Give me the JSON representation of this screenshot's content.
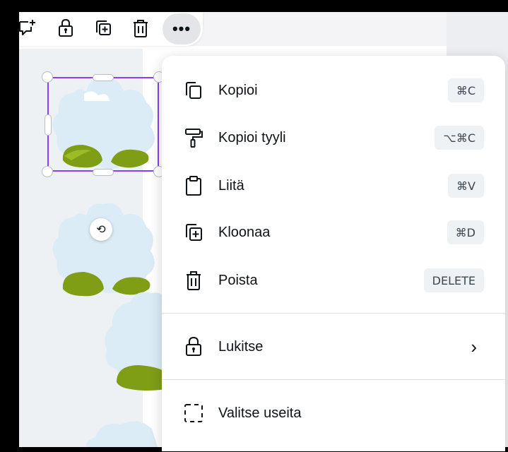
{
  "toolbar": {
    "icons": [
      "comment-add-icon",
      "lock-icon",
      "duplicate-icon",
      "trash-icon"
    ],
    "more_label": "•••"
  },
  "canvas": {
    "rotate_glyph": "⟲"
  },
  "menu": {
    "items": [
      {
        "label": "Kopioi",
        "shortcut": "⌘C",
        "icon": "copy-icon"
      },
      {
        "label": "Kopioi tyyli",
        "shortcut": "⌥⌘C",
        "icon": "paint-roller-icon"
      },
      {
        "label": "Liitä",
        "shortcut": "⌘V",
        "icon": "clipboard-icon"
      },
      {
        "label": "Kloonaa",
        "shortcut": "⌘D",
        "icon": "duplicate-icon"
      },
      {
        "label": "Poista",
        "shortcut": "DELETE",
        "icon": "trash-icon"
      }
    ],
    "lock": {
      "label": "Lukitse",
      "icon": "lock-icon",
      "chevron": "›"
    },
    "multi": {
      "label": "Valitse useita",
      "icon": "dashed-select-icon"
    }
  },
  "colors": {
    "accent": "#8b3dff",
    "cloud": "#dcecf6",
    "grass": "#7f9e16",
    "grass_dark": "#5e7f0e"
  }
}
